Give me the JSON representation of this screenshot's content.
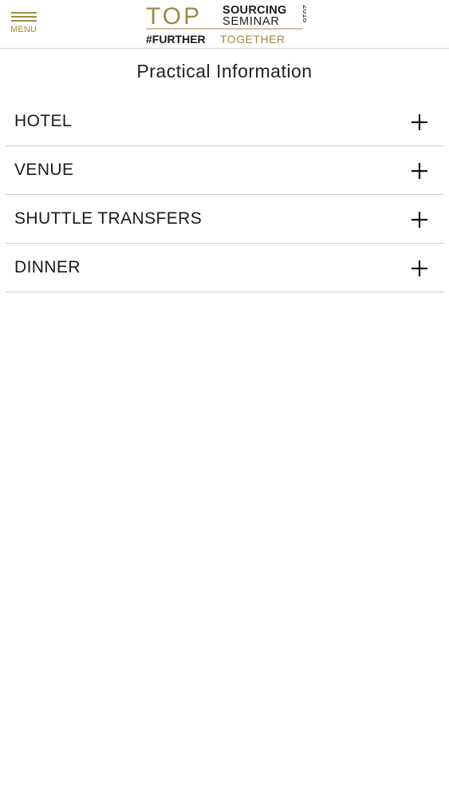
{
  "header": {
    "menu_label": "MENU",
    "logo": {
      "word_top": "TOP",
      "word_sourcing": "SOURCING",
      "word_seminar": "SEMINAR",
      "year": "2018",
      "tagline_left": "#FURTHER",
      "tagline_right": "TOGETHER"
    }
  },
  "page": {
    "title": "Practical Information"
  },
  "accordion": {
    "items": [
      {
        "label": "HOTEL"
      },
      {
        "label": "VENUE"
      },
      {
        "label": "SHUTTLE TRANSFERS"
      },
      {
        "label": "DINNER"
      }
    ]
  },
  "colors": {
    "brand_gold": "#a08a42",
    "text": "#1a1a1a",
    "divider": "#d0d0d0"
  }
}
